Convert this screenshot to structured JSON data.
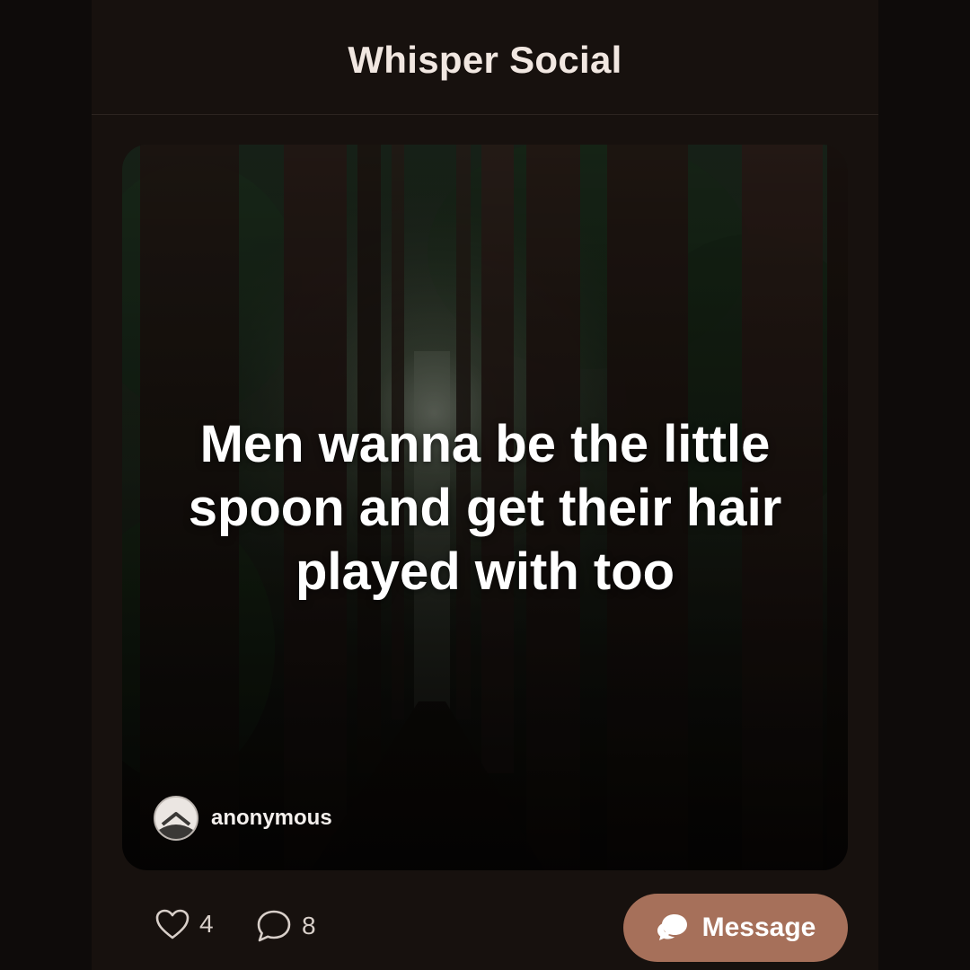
{
  "header": {
    "title": "Whisper Social"
  },
  "post": {
    "text": "Men wanna be the little spoon and get their hair played with too",
    "author": "anonymous",
    "background_scene": "dark-forest"
  },
  "actions": {
    "likes": "4",
    "comments": "8",
    "message_label": "Message"
  },
  "icons": {
    "like": "heart-icon",
    "comment": "comment-bubble-icon",
    "message": "chat-bubbles-icon",
    "avatar": "anonymous-avatar-icon"
  },
  "colors": {
    "background": "#0e0b0a",
    "app_surface": "#17110e",
    "accent": "#a6705a",
    "text_primary": "#f1e7e1"
  }
}
